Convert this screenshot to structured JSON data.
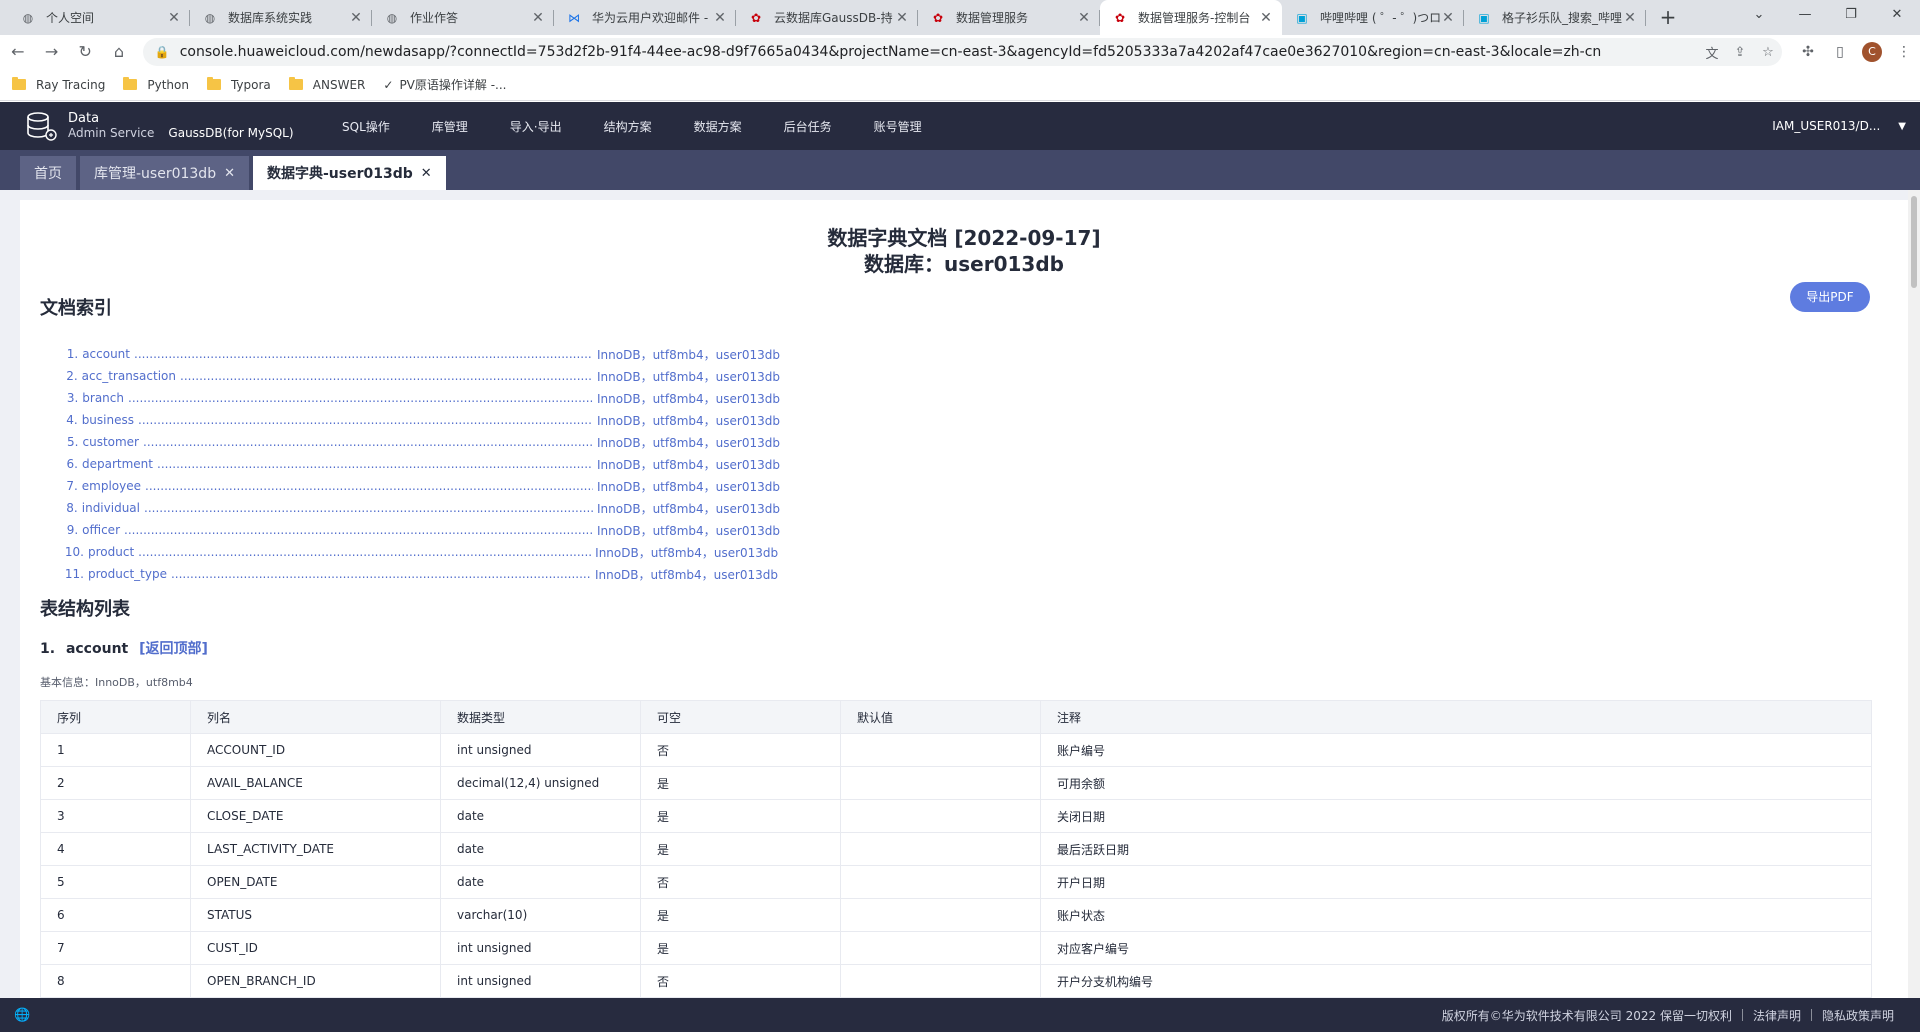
{
  "browser": {
    "tabs": [
      {
        "title": "个人空间",
        "icon": "globe-icon",
        "active": false
      },
      {
        "title": "数据库系统实践",
        "icon": "globe-icon",
        "active": false
      },
      {
        "title": "作业作答",
        "icon": "globe-icon",
        "active": false
      },
      {
        "title": "华为云用户欢迎邮件 -",
        "icon": "mail-icon",
        "active": false
      },
      {
        "title": "云数据库GaussDB-持",
        "icon": "huawei-icon",
        "active": false
      },
      {
        "title": "数据管理服务",
        "icon": "huawei-icon",
        "active": false
      },
      {
        "title": "数据管理服务-控制台",
        "icon": "huawei-icon",
        "active": true
      },
      {
        "title": "哔哩哔哩 ( ゜- ゜)つロ",
        "icon": "bilibili-icon",
        "active": false
      },
      {
        "title": "格子衫乐队_搜索_哔哩",
        "icon": "bilibili-icon",
        "active": false
      }
    ],
    "url": "console.huaweicloud.com/newdasapp/?connectId=753d2f2b-91f4-44ee-ac98-d9f7665a0434&projectName=cn-east-3&agencyId=fd5205333a7a4202af47cae0e3627010&region=cn-east-3&locale=zh-cn",
    "avatar_letter": "C",
    "bookmarks": [
      {
        "label": "Ray Tracing",
        "type": "folder"
      },
      {
        "label": "Python",
        "type": "folder"
      },
      {
        "label": "Typora",
        "type": "folder"
      },
      {
        "label": "ANSWER",
        "type": "folder"
      },
      {
        "label": "PV原语操作详解 -...",
        "type": "page"
      }
    ]
  },
  "app": {
    "logo_line1": "Data",
    "logo_line2": "Admin Service",
    "engine": "GaussDB(for MySQL)",
    "menu": [
      "SQL操作",
      "库管理",
      "导入·导出",
      "结构方案",
      "数据方案",
      "后台任务",
      "账号管理"
    ],
    "user": "IAM_USER013/D..."
  },
  "subtabs": [
    {
      "label": "首页",
      "closable": false,
      "active": false
    },
    {
      "label": "库管理-user013db",
      "closable": true,
      "active": false
    },
    {
      "label": "数据字典-user013db",
      "closable": true,
      "active": true
    }
  ],
  "doc": {
    "title_line1": "数据字典文档 [2022-09-17]",
    "title_line2": "数据库：user013db",
    "export_label": "导出PDF",
    "index_heading": "文档索引",
    "index_items": [
      {
        "num": "1.",
        "name": "account",
        "info": "InnoDB，utf8mb4，user013db"
      },
      {
        "num": "2.",
        "name": "acc_transaction",
        "info": "InnoDB，utf8mb4，user013db"
      },
      {
        "num": "3.",
        "name": "branch",
        "info": "InnoDB，utf8mb4，user013db"
      },
      {
        "num": "4.",
        "name": "business",
        "info": "InnoDB，utf8mb4，user013db"
      },
      {
        "num": "5.",
        "name": "customer",
        "info": "InnoDB，utf8mb4，user013db"
      },
      {
        "num": "6.",
        "name": "department",
        "info": "InnoDB，utf8mb4，user013db"
      },
      {
        "num": "7.",
        "name": "employee",
        "info": "InnoDB，utf8mb4，user013db"
      },
      {
        "num": "8.",
        "name": "individual",
        "info": "InnoDB，utf8mb4，user013db"
      },
      {
        "num": "9.",
        "name": "officer",
        "info": "InnoDB，utf8mb4，user013db"
      },
      {
        "num": "10.",
        "name": "product",
        "info": "InnoDB，utf8mb4，user013db"
      },
      {
        "num": "11.",
        "name": "product_type",
        "info": "InnoDB，utf8mb4，user013db"
      }
    ],
    "structure_heading": "表结构列表",
    "section_num": "1.",
    "section_name": "account",
    "back_to_top": "[返回顶部]",
    "basic_info": "基本信息：InnoDB，utf8mb4",
    "columns": [
      "序列",
      "列名",
      "数据类型",
      "可空",
      "默认值",
      "注释"
    ],
    "rows": [
      [
        "1",
        "ACCOUNT_ID",
        "int unsigned",
        "否",
        "",
        "账户编号"
      ],
      [
        "2",
        "AVAIL_BALANCE",
        "decimal(12,4) unsigned",
        "是",
        "",
        "可用余额"
      ],
      [
        "3",
        "CLOSE_DATE",
        "date",
        "是",
        "",
        "关闭日期"
      ],
      [
        "4",
        "LAST_ACTIVITY_DATE",
        "date",
        "是",
        "",
        "最后活跃日期"
      ],
      [
        "5",
        "OPEN_DATE",
        "date",
        "否",
        "",
        "开户日期"
      ],
      [
        "6",
        "STATUS",
        "varchar(10)",
        "是",
        "",
        "账户状态"
      ],
      [
        "7",
        "CUST_ID",
        "int unsigned",
        "是",
        "",
        "对应客户编号"
      ],
      [
        "8",
        "OPEN_BRANCH_ID",
        "int unsigned",
        "否",
        "",
        "开户分支机构编号"
      ]
    ]
  },
  "footer": {
    "copyright": "版权所有©华为软件技术有限公司 2022 保留一切权利",
    "legal": "法律声明",
    "privacy": "隐私政策声明"
  },
  "colors": {
    "header_bg": "#272b3f",
    "subtab_bg": "#424868",
    "link": "#526ecc",
    "primary_button": "#5e7ce0"
  }
}
